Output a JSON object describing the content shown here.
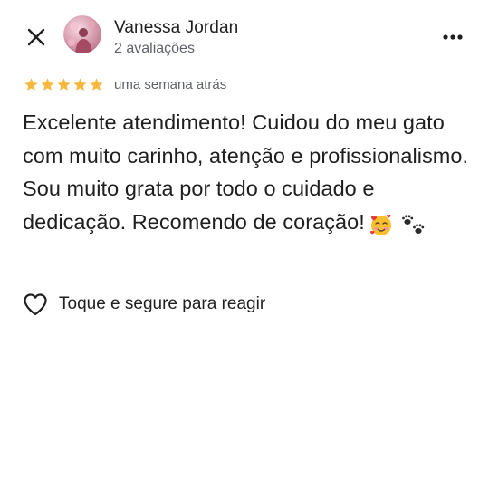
{
  "header": {
    "close_icon": "close-icon",
    "avatar_icon": "profile-photo",
    "user_name": "Vanessa Jordan",
    "user_meta": "2 avaliações",
    "more_icon": "more-vertical-icon"
  },
  "review": {
    "rating": 5,
    "rating_max": 5,
    "star_color": "#f6b73c",
    "time_ago": "uma semana atrás",
    "text": "Excelente atendimento! Cuidou do meu gato com muito carinho, atenção e profissionalismo. Sou muito grata por todo o cuidado e dedicação. Recomendo de coração!",
    "emojis": [
      "smiling-face-with-hearts",
      "paw-prints"
    ]
  },
  "reaction": {
    "icon": "heart-outline-icon",
    "label": "Toque e segure para reagir"
  }
}
